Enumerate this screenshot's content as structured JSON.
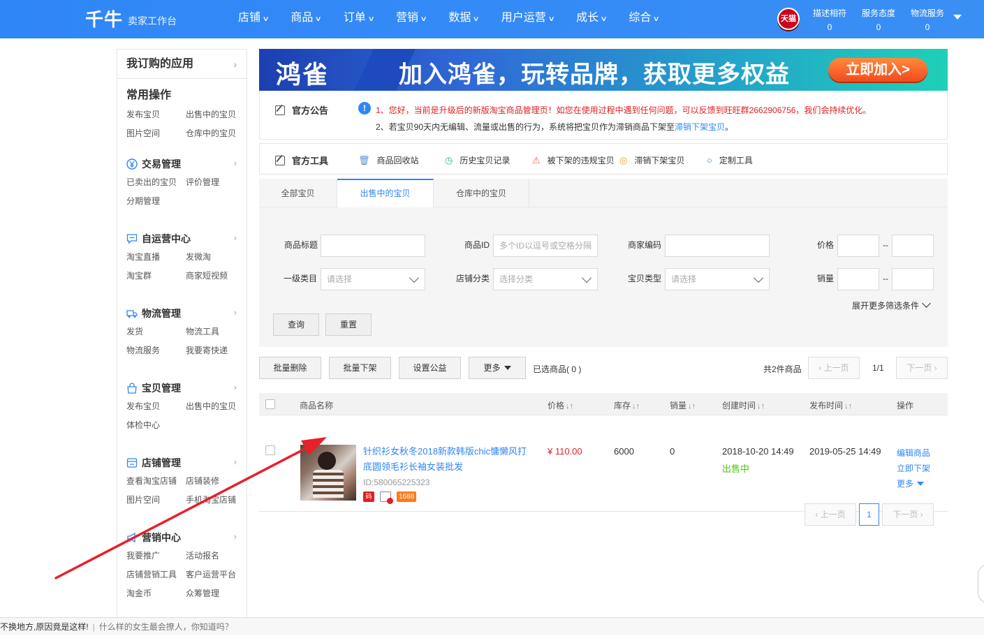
{
  "header": {
    "logo": "千牛",
    "subtitle": "卖家工作台",
    "nav": [
      "店铺",
      "商品",
      "订单",
      "营销",
      "数据",
      "用户运营",
      "成长",
      "综合"
    ],
    "badge": "天猫",
    "scores": [
      {
        "label": "描述相符",
        "value": "0"
      },
      {
        "label": "服务态度",
        "value": "0"
      },
      {
        "label": "物流服务",
        "value": "0"
      }
    ]
  },
  "sidebar": {
    "head": "我订购的应用",
    "common": {
      "title": "常用操作",
      "links": [
        "发布宝贝",
        "出售中的宝贝",
        "图片空间",
        "仓库中的宝贝"
      ]
    },
    "sections": [
      {
        "title": "交易管理",
        "icon": "yen-icon",
        "links": [
          "已卖出的宝贝",
          "评价管理",
          "分期管理"
        ]
      },
      {
        "title": "自运营中心",
        "icon": "chat-icon",
        "links": [
          "淘宝直播",
          "发微淘",
          "淘宝群",
          "商家短视频"
        ]
      },
      {
        "title": "物流管理",
        "icon": "truck-icon",
        "links": [
          "发货",
          "物流工具",
          "物流服务",
          "我要寄快递"
        ]
      },
      {
        "title": "宝贝管理",
        "icon": "bag-icon",
        "links": [
          "发布宝贝",
          "出售中的宝贝",
          "体检中心"
        ]
      },
      {
        "title": "店铺管理",
        "icon": "store-icon",
        "links": [
          "查看淘宝店铺",
          "店铺装修",
          "图片空间",
          "手机淘宝店铺"
        ]
      },
      {
        "title": "营销中心",
        "icon": "megaphone-icon",
        "links": [
          "我要推广",
          "活动报名",
          "店铺营销工具",
          "客户运营平台",
          "淘金币",
          "众筹管理"
        ]
      }
    ]
  },
  "banner": {
    "logo": "鸿雀",
    "text": "加入鸿雀，玩转品牌，获取更多权益",
    "button": "立即加入>"
  },
  "notice": {
    "title": "官方公告",
    "line1": "1、您好，当前是升级后的新版淘宝商品管理页！如您在使用过程中遇到任何问题，可以反馈到旺旺群2662906756，我们会持续优化。",
    "line2_pre": "2、若宝贝90天内无编辑、流量或出售的行为，系统将把宝贝作为滞销商品下架至",
    "line2_link": "滞销下架宝贝",
    "line2_post": "。"
  },
  "tools": {
    "title": "官方工具",
    "items": [
      "商品回收站",
      "历史宝贝记录",
      "被下架的违规宝贝",
      "滞销下架宝贝",
      "定制工具"
    ]
  },
  "tabs": [
    "全部宝贝",
    "出售中的宝贝",
    "仓库中的宝贝"
  ],
  "filter": {
    "title_label": "商品标题",
    "id_label": "商品ID",
    "id_placeholder": "多个ID以逗号或空格分隔",
    "code_label": "商家编码",
    "price_label": "价格",
    "cat_label": "一级类目",
    "cat_placeholder": "请选择",
    "shopcat_label": "店铺分类",
    "shopcat_placeholder": "选择分类",
    "type_label": "宝贝类型",
    "type_placeholder": "请选择",
    "sales_label": "销量",
    "dash": "--",
    "expand": "展开更多筛选条件",
    "query": "查询",
    "reset": "重置"
  },
  "actions": {
    "batch_delete": "批量删除",
    "batch_off": "批量下架",
    "set_charity": "设置公益",
    "more": "更多",
    "selected": "已选商品( 0 )",
    "total": "共2件商品",
    "prev": "上一页",
    "page": "1/1",
    "next": "下一页"
  },
  "table": {
    "headers": [
      "商品名称",
      "价格",
      "库存",
      "销量",
      "创建时间",
      "发布时间",
      "操作"
    ],
    "rows": [
      {
        "name": "针织衫女秋冬2018新款韩版chic慵懒风打底圆领毛衫长袖女装批发",
        "id": "ID:580065225323",
        "tag1": "码",
        "tag3": "1688",
        "price": "¥ 110.00",
        "stock": "6000",
        "sales": "0",
        "created": "2018-10-20 14:49",
        "status": "出售中",
        "published": "2019-05-25 14:49",
        "ops": [
          "编辑商品",
          "立即下架",
          "更多"
        ]
      }
    ]
  },
  "pager": {
    "prev": "上一页",
    "page": "1",
    "next": "下一页"
  },
  "bottombar": {
    "text1": "不换地方,原因竟是这样!",
    "sep": "|",
    "text2": "什么样的女生最会撩人，你知道吗？"
  },
  "colors": {
    "brand": "#2f86f6",
    "price": "#e02020",
    "status": "#52c41a",
    "annotation_arrow": "#e8202a"
  }
}
